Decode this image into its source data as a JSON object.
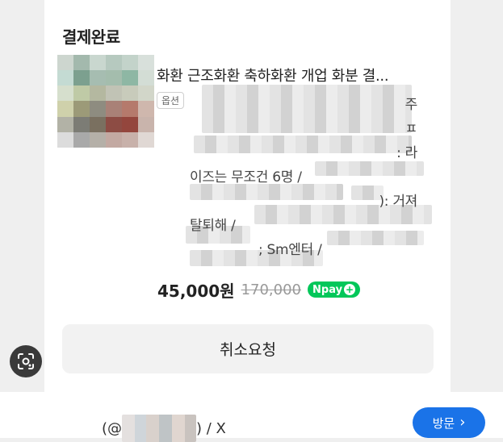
{
  "order": {
    "status": "결제완료",
    "product_title": "화환 근조화환 축하화환 개업 화분 결...",
    "option_badge": "옵션",
    "option_lines": [
      "주",
      "ㅍ",
      ": 라",
      "이즈는 무조건 6명 /",
      "): 거져",
      "탈퇴해 /",
      "; Sm엔터 /",
      ""
    ],
    "price": "45,000원",
    "original_price": "170,000",
    "pay_badge": "Npay",
    "pay_plus": "+",
    "cancel_label": "취소요청"
  },
  "footer": {
    "account_prefix": "(@",
    "account_suffix": ") / X",
    "visit_label": "방문",
    "visit_chevron": "›"
  },
  "icons": {
    "lens": "lens-icon"
  },
  "colors": {
    "npay_green": "#03c75a",
    "visit_blue": "#1a73e8"
  }
}
